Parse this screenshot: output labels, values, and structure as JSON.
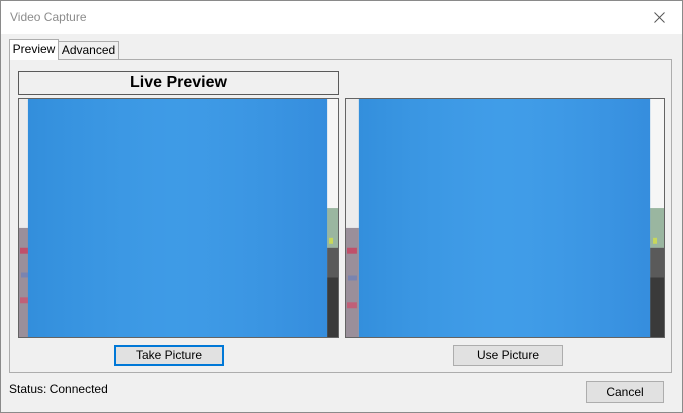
{
  "window": {
    "title": "Video Capture"
  },
  "tabs": [
    {
      "label": "Preview",
      "active": true
    },
    {
      "label": "Advanced",
      "active": false
    }
  ],
  "preview": {
    "live_title": "Live Preview",
    "take_picture_label": "Take Picture",
    "use_picture_label": "Use Picture"
  },
  "status": {
    "label": "Status:",
    "value": "Connected"
  },
  "footer": {
    "cancel_label": "Cancel"
  },
  "colors": {
    "focus_border": "#0078d7",
    "cloth_blue": "#3e9ae6",
    "panel_bg": "#f0f0f0"
  }
}
